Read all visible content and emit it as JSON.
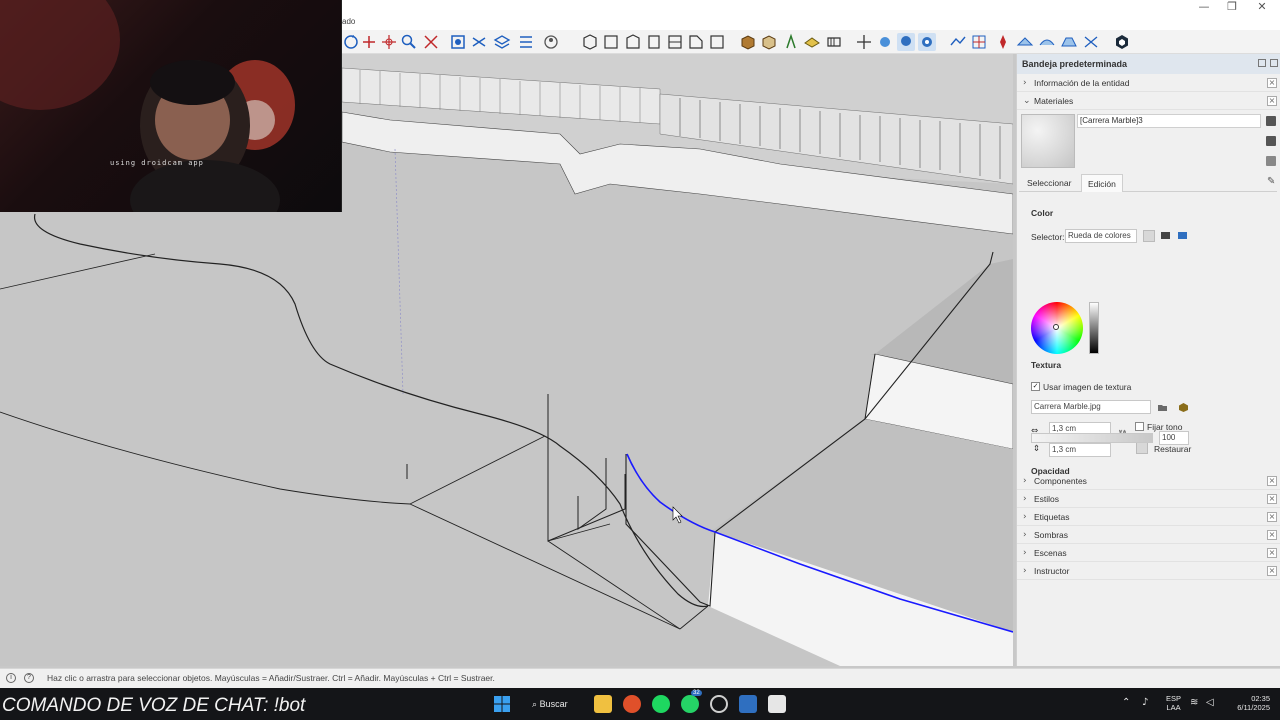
{
  "window": {
    "menu_fragment": "ado",
    "minimize": "—",
    "restore": "❐",
    "close": "✕"
  },
  "webcam": {
    "overlay_text": "using droidcam app"
  },
  "tray": {
    "title": "Bandeja predeterminada",
    "entity_info": "Información de la entidad",
    "materials": {
      "label": "Materiales",
      "material_name": "[Carrera Marble]3",
      "tab_select": "Seleccionar",
      "tab_edit": "Edición",
      "color_heading": "Color",
      "selector_label": "Selector:",
      "selector_value": "Rueda de colores",
      "texture_heading": "Textura",
      "use_texture_label": "Usar imagen de textura",
      "use_texture_checked": true,
      "texture_file": "Carrera Marble.jpg",
      "width_value": "1,3 cm",
      "height_value": "1,3 cm",
      "fix_tone_label": "Fijar tono",
      "restore_label": "Restaurar",
      "opacity_heading": "Opacidad",
      "opacity_value": "100"
    },
    "panels": [
      "Componentes",
      "Estilos",
      "Etiquetas",
      "Sombras",
      "Escenas",
      "Instructor"
    ]
  },
  "status": {
    "hint": "Haz clic o arrastra para seleccionar objetos. Mayúsculas = Añadir/Sustraer. Ctrl = Añadir. Mayúsculas + Ctrl = Sustraer."
  },
  "taskbar": {
    "chat_command": "COMANDO DE VOZ DE CHAT: !bot",
    "search_label": "Buscar",
    "whatsapp_badge": "32",
    "lang_line1": "ESP",
    "lang_line2": "LAA",
    "time": "02:35",
    "date": "6/11/2025"
  },
  "colors": {
    "selected_edge": "#1a1aff",
    "viewport_bg": "#c7c7c7",
    "taskbar_bg": "#141518"
  }
}
